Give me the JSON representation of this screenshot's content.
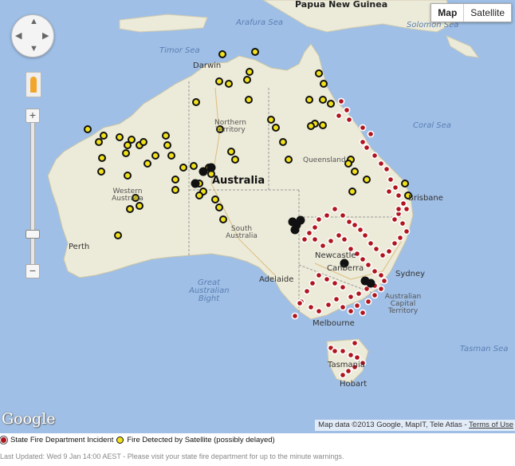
{
  "map_type_control": {
    "map_label": "Map",
    "satellite_label": "Satellite",
    "selected": "Map"
  },
  "labels": {
    "papua_new_guinea": "Papua New Guinea",
    "arafura_sea": "Arafura Sea",
    "timor_sea": "Timor Sea",
    "solomon_sea": "Solomon Sea",
    "coral_sea": "Coral Sea",
    "tasman_sea": "Tasman Sea",
    "great_australian_bight": "Great Australian Bight",
    "northern_territory": "Northern Territory",
    "queensland": "Queensland",
    "western_australia": "Western Australia",
    "south_australia": "South Australia",
    "act": "Australian Capital Territory",
    "australia": "Australia",
    "darwin": "Darwin",
    "perth": "Perth",
    "adelaide": "Adelaide",
    "melbourne": "Melbourne",
    "sydney": "Sydney",
    "canberra": "Canberra",
    "hobart": "Hobart",
    "brisbane": "Brisbane",
    "newcastle": "Newcastle",
    "tasmania": "Tasmania"
  },
  "attribution": {
    "map_data": "Map data ©2013 Google, MapIT, Tele Atlas - ",
    "terms": "Terms of Use"
  },
  "logo_text": "Google",
  "legend": {
    "state_incident": "State Fire Department Incident",
    "satellite": "Fire Detected by Satellite (possibly delayed)"
  },
  "last_updated": "Last Updated: Wed 9 Jan 14:00 AEST - Please visit your state fire department for up to the minute warnings.",
  "colors": {
    "water": "#9fbfe6",
    "land": "#ecead8",
    "incident_marker": "#b0141e",
    "satellite_marker": "#f1e11a"
  },
  "icons": [
    "pan-control-icon",
    "pegman-icon",
    "zoom-in-icon",
    "zoom-out-icon"
  ]
}
